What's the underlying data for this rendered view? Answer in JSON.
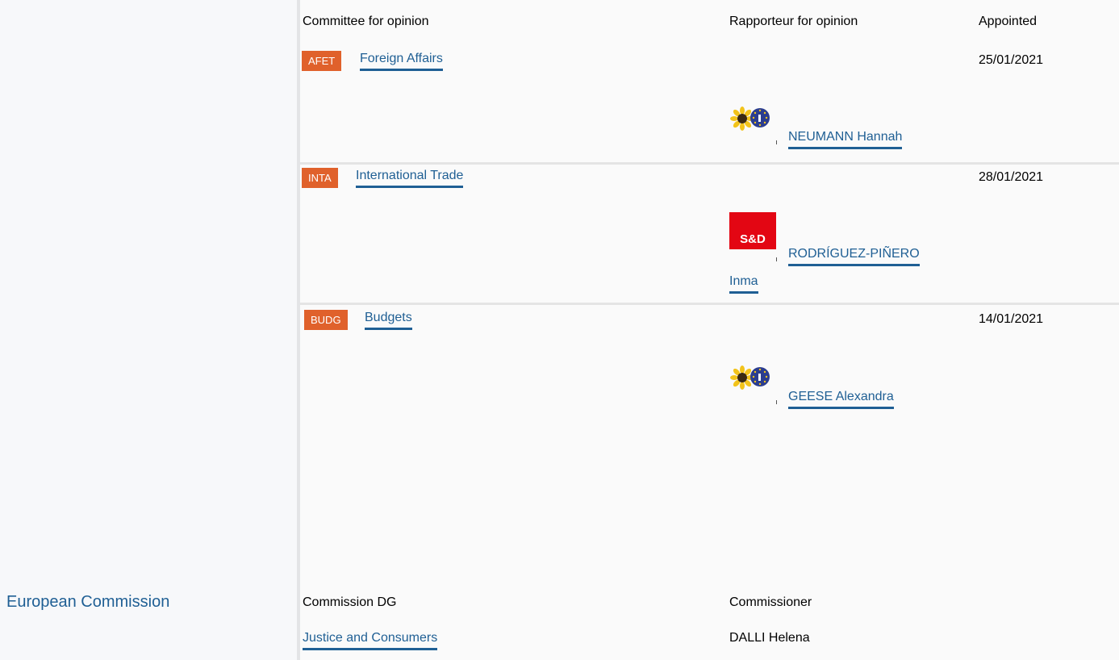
{
  "headers": {
    "committee": "Committee for opinion",
    "rapporteur": "Rapporteur for opinion",
    "appointed": "Appointed"
  },
  "committees": [
    {
      "code": "AFET",
      "name": "Foreign Affairs",
      "date": "25/01/2021",
      "rapporteur": "NEUMANN Hannah",
      "group_icon": "greens-efa-sunflower-icon"
    },
    {
      "code": "INTA",
      "name": "International Trade",
      "date": "28/01/2021",
      "rapporteur_line1": "RODRÍGUEZ-PIÑERO",
      "rapporteur_line2": "Inma",
      "group_icon": "s-and-d-logo-icon",
      "group_logo_text": "S&D"
    },
    {
      "code": "BUDG",
      "name": "Budgets",
      "date": "14/01/2021",
      "rapporteur": "GEESE Alexandra",
      "group_icon": "greens-efa-sunflower-icon"
    }
  ],
  "commission": {
    "title": "European Commission",
    "dg_header": "Commission DG",
    "commissioner_header": "Commissioner",
    "dg_name": "Justice and Consumers",
    "commissioner_name": "DALLI Helena"
  },
  "colors": {
    "badge": "#e0612b",
    "link": "#1f5f94",
    "sd_red": "#e30613"
  }
}
